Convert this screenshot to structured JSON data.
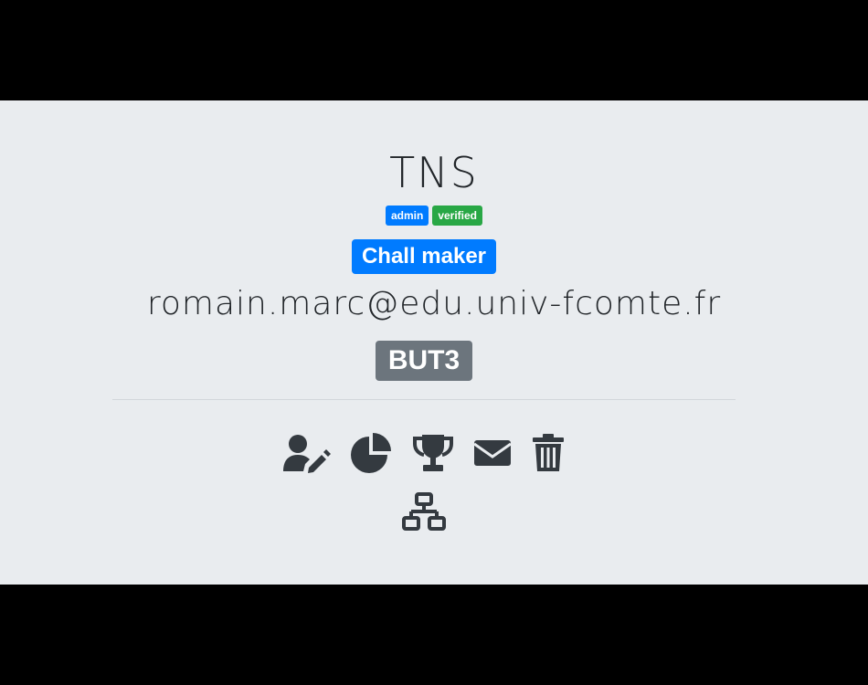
{
  "user": {
    "name": "TNS",
    "email": "romain.marc@edu.univ-fcomte.fr"
  },
  "badges": {
    "admin": "admin",
    "verified": "verified"
  },
  "role_label": "Chall maker",
  "group_label": "BUT3",
  "actions": [
    {
      "icon": "user-edit-icon"
    },
    {
      "icon": "pie-chart-icon"
    },
    {
      "icon": "trophy-icon"
    },
    {
      "icon": "envelope-icon"
    },
    {
      "icon": "trash-icon"
    },
    {
      "icon": "network-icon"
    }
  ],
  "colors": {
    "panel_bg": "#e9ecef",
    "primary": "#007bff",
    "success": "#28a745",
    "secondary": "#6c757d",
    "text": "#212529",
    "icon": "#343a40"
  }
}
